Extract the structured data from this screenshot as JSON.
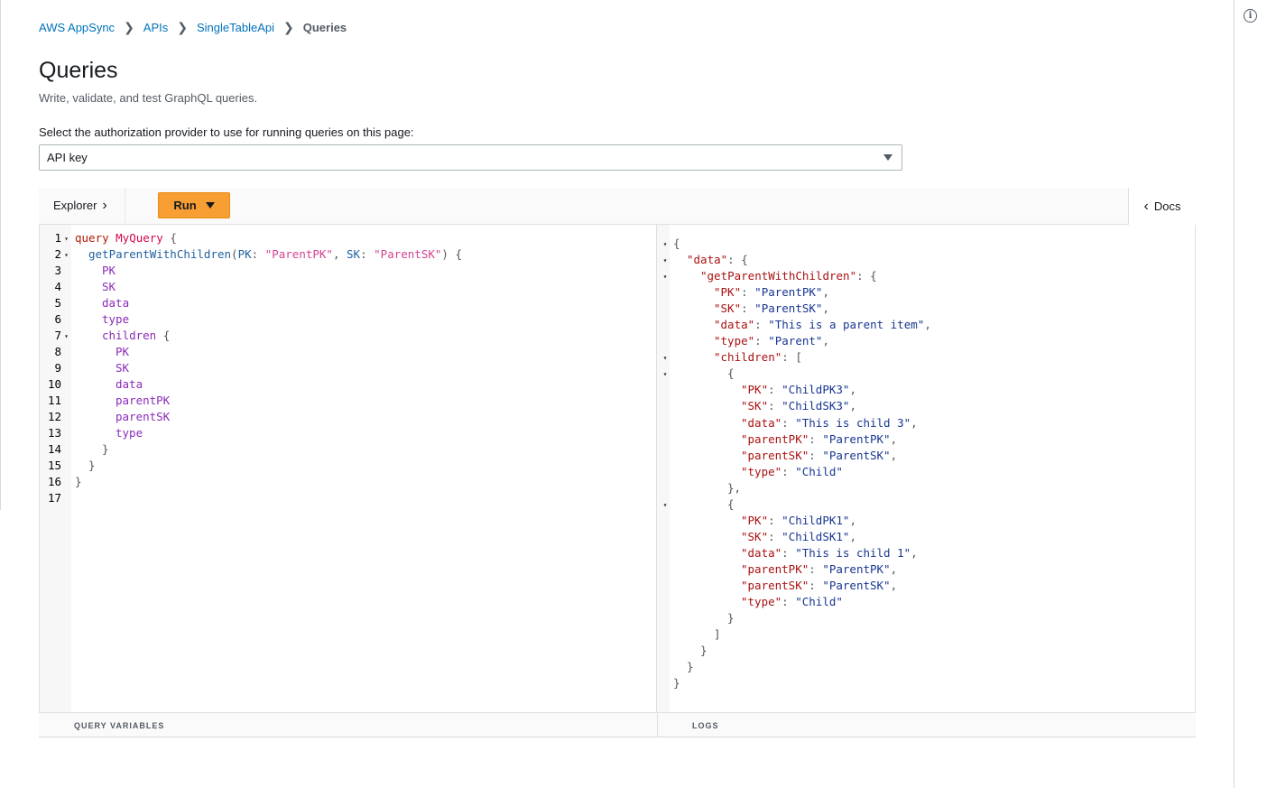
{
  "breadcrumb": {
    "items": [
      "AWS AppSync",
      "APIs",
      "SingleTableApi"
    ],
    "current": "Queries"
  },
  "page": {
    "title": "Queries",
    "description": "Write, validate, and test GraphQL queries."
  },
  "auth": {
    "label": "Select the authorization provider to use for running queries on this page:",
    "selected": "API key"
  },
  "toolbar": {
    "explorer_label": "Explorer",
    "run_label": "Run",
    "docs_label": "Docs"
  },
  "query_editor": {
    "lines": [
      {
        "n": "1",
        "fold": true,
        "indent": 0,
        "parts": [
          [
            "q-kw",
            "query "
          ],
          [
            "q-name",
            "MyQuery"
          ],
          [
            "c-punc",
            " {"
          ]
        ]
      },
      {
        "n": "2",
        "fold": true,
        "indent": 1,
        "parts": [
          [
            "c-prop",
            "getParentWithChildren"
          ],
          [
            "c-punc",
            "("
          ],
          [
            "c-attr",
            "PK"
          ],
          [
            "c-punc",
            ": "
          ],
          [
            "c-str",
            "\"ParentPK\""
          ],
          [
            "c-punc",
            ", "
          ],
          [
            "c-attr",
            "SK"
          ],
          [
            "c-punc",
            ": "
          ],
          [
            "c-str",
            "\"ParentSK\""
          ],
          [
            "c-punc",
            ") {"
          ]
        ]
      },
      {
        "n": "3",
        "fold": false,
        "indent": 2,
        "parts": [
          [
            "c-sel",
            "PK"
          ]
        ]
      },
      {
        "n": "4",
        "fold": false,
        "indent": 2,
        "parts": [
          [
            "c-sel",
            "SK"
          ]
        ]
      },
      {
        "n": "5",
        "fold": false,
        "indent": 2,
        "parts": [
          [
            "c-sel",
            "data"
          ]
        ]
      },
      {
        "n": "6",
        "fold": false,
        "indent": 2,
        "parts": [
          [
            "c-sel",
            "type"
          ]
        ]
      },
      {
        "n": "7",
        "fold": true,
        "indent": 2,
        "parts": [
          [
            "c-sel",
            "children"
          ],
          [
            "c-punc",
            " {"
          ]
        ]
      },
      {
        "n": "8",
        "fold": false,
        "indent": 3,
        "parts": [
          [
            "c-sel",
            "PK"
          ]
        ]
      },
      {
        "n": "9",
        "fold": false,
        "indent": 3,
        "parts": [
          [
            "c-sel",
            "SK"
          ]
        ]
      },
      {
        "n": "10",
        "fold": false,
        "indent": 3,
        "parts": [
          [
            "c-sel",
            "data"
          ]
        ]
      },
      {
        "n": "11",
        "fold": false,
        "indent": 3,
        "parts": [
          [
            "c-sel",
            "parentPK"
          ]
        ]
      },
      {
        "n": "12",
        "fold": false,
        "indent": 3,
        "parts": [
          [
            "c-sel",
            "parentSK"
          ]
        ]
      },
      {
        "n": "13",
        "fold": false,
        "indent": 3,
        "parts": [
          [
            "c-sel",
            "type"
          ]
        ]
      },
      {
        "n": "14",
        "fold": false,
        "indent": 2,
        "parts": [
          [
            "c-punc",
            "}"
          ]
        ]
      },
      {
        "n": "15",
        "fold": false,
        "indent": 1,
        "parts": [
          [
            "c-punc",
            "}"
          ]
        ]
      },
      {
        "n": "16",
        "fold": false,
        "indent": 0,
        "parts": [
          [
            "c-punc",
            "}"
          ]
        ]
      },
      {
        "n": "17",
        "fold": false,
        "indent": 0,
        "parts": []
      }
    ]
  },
  "result_viewer": {
    "lines": [
      {
        "fold": true,
        "indent": 0,
        "parts": [
          [
            "c-punc",
            "{"
          ]
        ]
      },
      {
        "fold": true,
        "indent": 1,
        "parts": [
          [
            "j-key",
            "\"data\""
          ],
          [
            "c-punc",
            ": {"
          ]
        ]
      },
      {
        "fold": true,
        "indent": 2,
        "parts": [
          [
            "j-key",
            "\"getParentWithChildren\""
          ],
          [
            "c-punc",
            ": {"
          ]
        ]
      },
      {
        "fold": false,
        "indent": 3,
        "parts": [
          [
            "j-key",
            "\"PK\""
          ],
          [
            "c-punc",
            ": "
          ],
          [
            "j-str",
            "\"ParentPK\""
          ],
          [
            "c-punc",
            ","
          ]
        ]
      },
      {
        "fold": false,
        "indent": 3,
        "parts": [
          [
            "j-key",
            "\"SK\""
          ],
          [
            "c-punc",
            ": "
          ],
          [
            "j-str",
            "\"ParentSK\""
          ],
          [
            "c-punc",
            ","
          ]
        ]
      },
      {
        "fold": false,
        "indent": 3,
        "parts": [
          [
            "j-key",
            "\"data\""
          ],
          [
            "c-punc",
            ": "
          ],
          [
            "j-str",
            "\"This is a parent item\""
          ],
          [
            "c-punc",
            ","
          ]
        ]
      },
      {
        "fold": false,
        "indent": 3,
        "parts": [
          [
            "j-key",
            "\"type\""
          ],
          [
            "c-punc",
            ": "
          ],
          [
            "j-str",
            "\"Parent\""
          ],
          [
            "c-punc",
            ","
          ]
        ]
      },
      {
        "fold": true,
        "indent": 3,
        "parts": [
          [
            "j-key",
            "\"children\""
          ],
          [
            "c-punc",
            ": ["
          ]
        ]
      },
      {
        "fold": true,
        "indent": 4,
        "parts": [
          [
            "c-punc",
            "{"
          ]
        ]
      },
      {
        "fold": false,
        "indent": 5,
        "parts": [
          [
            "j-key",
            "\"PK\""
          ],
          [
            "c-punc",
            ": "
          ],
          [
            "j-str",
            "\"ChildPK3\""
          ],
          [
            "c-punc",
            ","
          ]
        ]
      },
      {
        "fold": false,
        "indent": 5,
        "parts": [
          [
            "j-key",
            "\"SK\""
          ],
          [
            "c-punc",
            ": "
          ],
          [
            "j-str",
            "\"ChildSK3\""
          ],
          [
            "c-punc",
            ","
          ]
        ]
      },
      {
        "fold": false,
        "indent": 5,
        "parts": [
          [
            "j-key",
            "\"data\""
          ],
          [
            "c-punc",
            ": "
          ],
          [
            "j-str",
            "\"This is child 3\""
          ],
          [
            "c-punc",
            ","
          ]
        ]
      },
      {
        "fold": false,
        "indent": 5,
        "parts": [
          [
            "j-key",
            "\"parentPK\""
          ],
          [
            "c-punc",
            ": "
          ],
          [
            "j-str",
            "\"ParentPK\""
          ],
          [
            "c-punc",
            ","
          ]
        ]
      },
      {
        "fold": false,
        "indent": 5,
        "parts": [
          [
            "j-key",
            "\"parentSK\""
          ],
          [
            "c-punc",
            ": "
          ],
          [
            "j-str",
            "\"ParentSK\""
          ],
          [
            "c-punc",
            ","
          ]
        ]
      },
      {
        "fold": false,
        "indent": 5,
        "parts": [
          [
            "j-key",
            "\"type\""
          ],
          [
            "c-punc",
            ": "
          ],
          [
            "j-str",
            "\"Child\""
          ]
        ]
      },
      {
        "fold": false,
        "indent": 4,
        "parts": [
          [
            "c-punc",
            "},"
          ]
        ]
      },
      {
        "fold": true,
        "indent": 4,
        "parts": [
          [
            "c-punc",
            "{"
          ]
        ]
      },
      {
        "fold": false,
        "indent": 5,
        "parts": [
          [
            "j-key",
            "\"PK\""
          ],
          [
            "c-punc",
            ": "
          ],
          [
            "j-str",
            "\"ChildPK1\""
          ],
          [
            "c-punc",
            ","
          ]
        ]
      },
      {
        "fold": false,
        "indent": 5,
        "parts": [
          [
            "j-key",
            "\"SK\""
          ],
          [
            "c-punc",
            ": "
          ],
          [
            "j-str",
            "\"ChildSK1\""
          ],
          [
            "c-punc",
            ","
          ]
        ]
      },
      {
        "fold": false,
        "indent": 5,
        "parts": [
          [
            "j-key",
            "\"data\""
          ],
          [
            "c-punc",
            ": "
          ],
          [
            "j-str",
            "\"This is child 1\""
          ],
          [
            "c-punc",
            ","
          ]
        ]
      },
      {
        "fold": false,
        "indent": 5,
        "parts": [
          [
            "j-key",
            "\"parentPK\""
          ],
          [
            "c-punc",
            ": "
          ],
          [
            "j-str",
            "\"ParentPK\""
          ],
          [
            "c-punc",
            ","
          ]
        ]
      },
      {
        "fold": false,
        "indent": 5,
        "parts": [
          [
            "j-key",
            "\"parentSK\""
          ],
          [
            "c-punc",
            ": "
          ],
          [
            "j-str",
            "\"ParentSK\""
          ],
          [
            "c-punc",
            ","
          ]
        ]
      },
      {
        "fold": false,
        "indent": 5,
        "parts": [
          [
            "j-key",
            "\"type\""
          ],
          [
            "c-punc",
            ": "
          ],
          [
            "j-str",
            "\"Child\""
          ]
        ]
      },
      {
        "fold": false,
        "indent": 4,
        "parts": [
          [
            "c-punc",
            "}"
          ]
        ]
      },
      {
        "fold": false,
        "indent": 3,
        "parts": [
          [
            "c-punc",
            "]"
          ]
        ]
      },
      {
        "fold": false,
        "indent": 2,
        "parts": [
          [
            "c-punc",
            "}"
          ]
        ]
      },
      {
        "fold": false,
        "indent": 1,
        "parts": [
          [
            "c-punc",
            "}"
          ]
        ]
      },
      {
        "fold": false,
        "indent": 0,
        "parts": [
          [
            "c-punc",
            "}"
          ]
        ]
      }
    ]
  },
  "bottom": {
    "query_variables_label": "QUERY VARIABLES",
    "logs_label": "LOGS"
  },
  "icons": {
    "info": "info-icon",
    "chevron_right": "chevron-right-icon",
    "chevron_left": "chevron-left-icon",
    "caret_down": "caret-down-icon"
  },
  "colors": {
    "link": "#0073bb",
    "run_button": "#f79f32",
    "text": "#16191f",
    "muted": "#545b64"
  }
}
